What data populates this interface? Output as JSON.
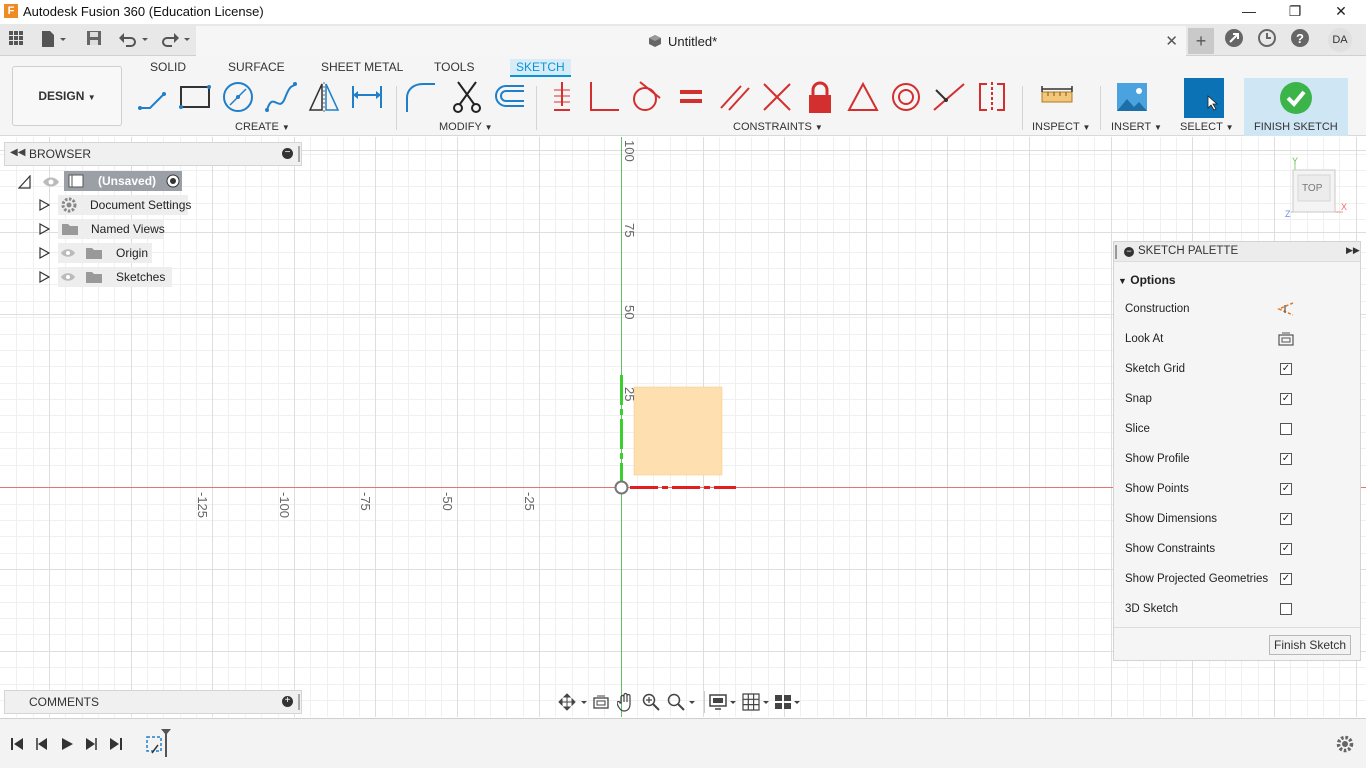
{
  "window": {
    "title": "Autodesk Fusion 360 (Education License)",
    "app_icon_letter": "F",
    "controls": [
      "minimize",
      "restore",
      "close"
    ]
  },
  "tabbar": {
    "document_title": "Untitled*",
    "user_initials": "DA"
  },
  "ribbon": {
    "workspace": "DESIGN",
    "tabs": [
      "SOLID",
      "SURFACE",
      "SHEET METAL",
      "TOOLS",
      "SKETCH"
    ],
    "active_tab": "SKETCH",
    "groups": {
      "create": "CREATE",
      "modify": "MODIFY",
      "constraints": "CONSTRAINTS",
      "inspect": "INSPECT",
      "insert": "INSERT",
      "select": "SELECT",
      "finish": "FINISH SKETCH"
    }
  },
  "browser": {
    "title": "BROWSER",
    "root": "(Unsaved)",
    "items": [
      "Document Settings",
      "Named Views",
      "Origin",
      "Sketches"
    ]
  },
  "comments": {
    "title": "COMMENTS"
  },
  "canvas": {
    "x_axis_labels": [
      "-125",
      "-100",
      "-75",
      "-50",
      "-25"
    ],
    "y_axis_labels": [
      "100",
      "75",
      "50",
      "25"
    ],
    "viewcube_label": "TOP"
  },
  "sketch_palette": {
    "title": "SKETCH PALETTE",
    "section": "Options",
    "options": [
      {
        "label": "Construction",
        "kind": "icon"
      },
      {
        "label": "Look At",
        "kind": "icon"
      },
      {
        "label": "Sketch Grid",
        "kind": "checkbox",
        "checked": true
      },
      {
        "label": "Snap",
        "kind": "checkbox",
        "checked": true
      },
      {
        "label": "Slice",
        "kind": "checkbox",
        "checked": false
      },
      {
        "label": "Show Profile",
        "kind": "checkbox",
        "checked": true
      },
      {
        "label": "Show Points",
        "kind": "checkbox",
        "checked": true
      },
      {
        "label": "Show Dimensions",
        "kind": "checkbox",
        "checked": true
      },
      {
        "label": "Show Constraints",
        "kind": "checkbox",
        "checked": true
      },
      {
        "label": "Show Projected Geometries",
        "kind": "checkbox",
        "checked": true
      },
      {
        "label": "3D Sketch",
        "kind": "checkbox",
        "checked": false
      }
    ],
    "finish_button": "Finish Sketch"
  },
  "colors": {
    "accent": "#0696d7",
    "profile_fill": "#fddfb0",
    "x_axis": "#e53935",
    "y_axis": "#43a047",
    "finish_green": "#3bb54a"
  }
}
